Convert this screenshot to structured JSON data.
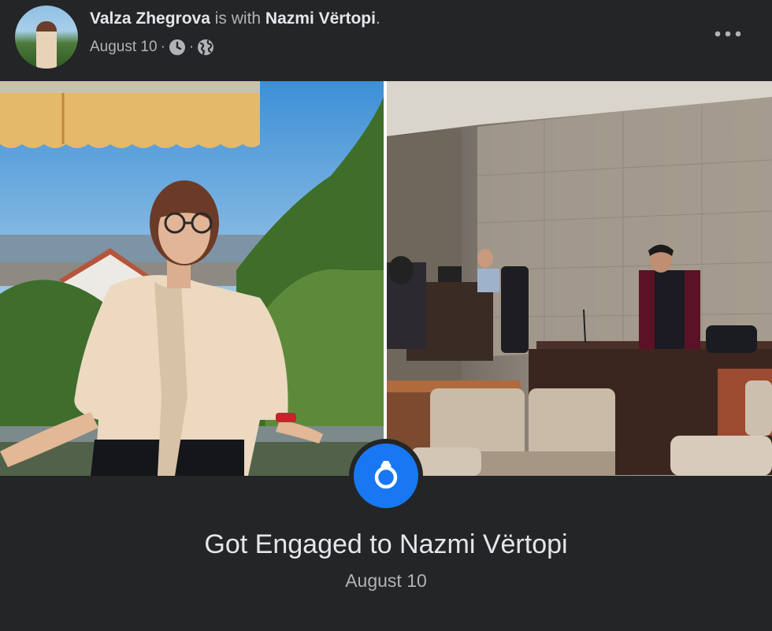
{
  "post": {
    "author": "Valza Zhegrova",
    "connector": " is with ",
    "tagged": "Nazmi Vërtopi",
    "period": ".",
    "date": "August 10",
    "separator": "·",
    "icons": [
      "clock-icon",
      "globe-icon",
      "more-options-icon"
    ]
  },
  "event": {
    "title": "Got Engaged to Nazmi Vërtopi",
    "date": "August 10",
    "icon": "ring-icon",
    "accent_color": "#1877f2"
  }
}
